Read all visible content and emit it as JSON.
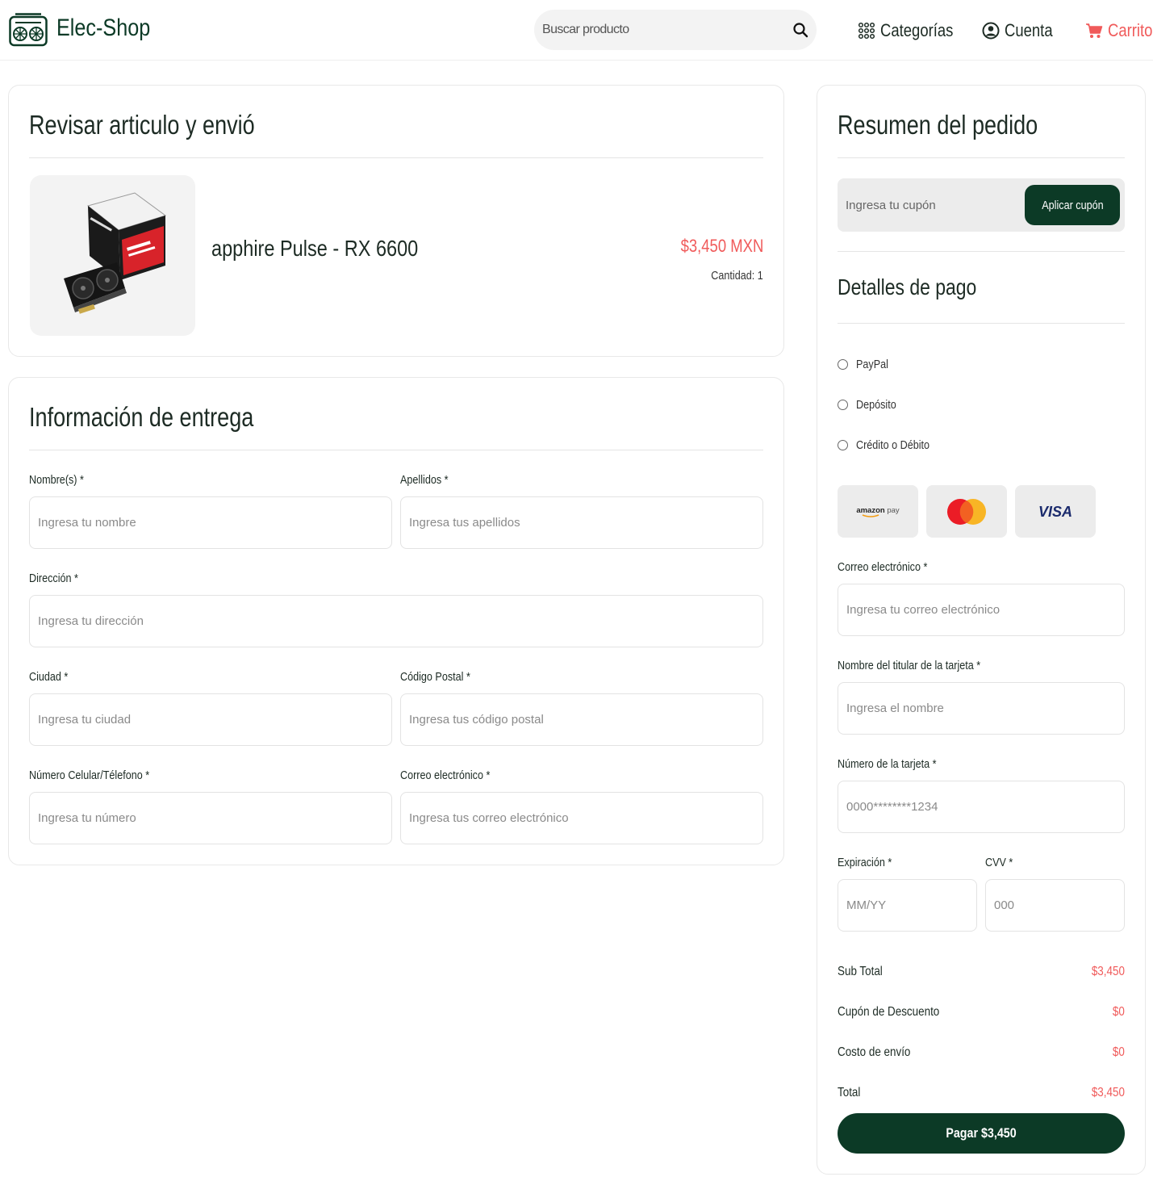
{
  "header": {
    "brand": "Elec-Shop",
    "search_placeholder": "Buscar producto",
    "nav": {
      "categories": "Categorías",
      "account": "Cuenta",
      "cart": "Carrito"
    }
  },
  "review": {
    "title": "Revisar articulo y envió",
    "product": {
      "name": "apphire Pulse - RX 6600",
      "price": "$3,450 MXN",
      "quantity": "Cantidad: 1"
    }
  },
  "delivery": {
    "title": "Información de entrega",
    "fields": {
      "first_name": {
        "label": "Nombre(s) *",
        "placeholder": "Ingresa tu nombre"
      },
      "last_name": {
        "label": "Apellidos *",
        "placeholder": "Ingresa tus apellidos"
      },
      "address": {
        "label": "Dirección *",
        "placeholder": "Ingresa tu dirección"
      },
      "city": {
        "label": "Ciudad *",
        "placeholder": "Ingresa tu ciudad"
      },
      "postal": {
        "label": "Código Postal *",
        "placeholder": "Ingresa tus código postal"
      },
      "phone": {
        "label": "Número Celular/Télefono *",
        "placeholder": "Ingresa tu número"
      },
      "email": {
        "label": "Correo electrónico *",
        "placeholder": "Ingresa tus correo electrónico"
      }
    }
  },
  "summary": {
    "title": "Resumen del pedido",
    "coupon_placeholder": "Ingresa tu cupón",
    "coupon_button": "Aplicar cupón",
    "payment_title": "Detalles de pago",
    "methods": [
      "PayPal",
      "Depósito",
      "Crédito o Débito"
    ],
    "cards": [
      "amazon pay",
      "mastercard",
      "VISA"
    ],
    "fields": {
      "email": {
        "label": "Correo electrónico *",
        "placeholder": "Ingresa tu correo electrónico"
      },
      "holder": {
        "label": "Nombre del titular de la tarjeta *",
        "placeholder": "Ingresa el nombre"
      },
      "number": {
        "label": "Número de la tarjeta *",
        "placeholder": "0000********1234"
      },
      "expiry": {
        "label": "Expiración *",
        "placeholder": "MM/YY"
      },
      "cvv": {
        "label": "CVV *",
        "placeholder": "000"
      }
    },
    "totals": [
      {
        "label": "Sub Total",
        "value": "$3,450"
      },
      {
        "label": "Cupón de Descuento",
        "value": "$0"
      },
      {
        "label": "Costo de envío",
        "value": "$0"
      },
      {
        "label": "Total",
        "value": "$3,450"
      }
    ],
    "pay_button": "Pagar $3,450"
  },
  "colors": {
    "brand": "#0c3a26",
    "accent": "#f05a5a"
  }
}
